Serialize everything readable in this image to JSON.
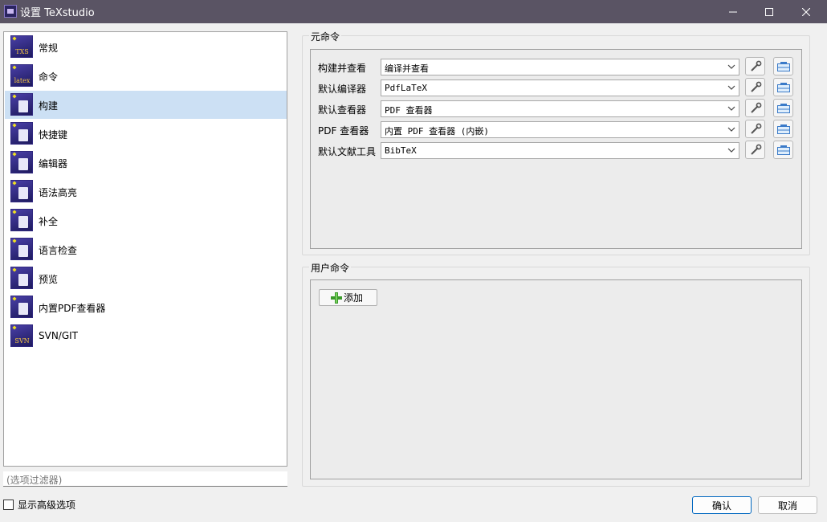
{
  "window": {
    "title": "设置 TeXstudio"
  },
  "sidebar": {
    "items": [
      {
        "label": "常规",
        "icon": "txs-icon",
        "sub": "TXS"
      },
      {
        "label": "命令",
        "icon": "latex-icon",
        "sub": "latex"
      },
      {
        "label": "构建",
        "icon": "build-icon",
        "sub": ""
      },
      {
        "label": "快捷键",
        "icon": "keyboard-icon",
        "sub": ""
      },
      {
        "label": "编辑器",
        "icon": "text-cursor-icon",
        "sub": ""
      },
      {
        "label": "语法高亮",
        "icon": "highlight-icon",
        "sub": ""
      },
      {
        "label": "补全",
        "icon": "completion-icon",
        "sub": ""
      },
      {
        "label": "语言检查",
        "icon": "spellcheck-icon",
        "sub": ""
      },
      {
        "label": "预览",
        "icon": "preview-icon",
        "sub": ""
      },
      {
        "label": "内置PDF查看器",
        "icon": "pdf-viewer-icon",
        "sub": ""
      },
      {
        "label": "SVN/GIT",
        "icon": "svn-icon",
        "sub": "SVN"
      }
    ],
    "selected": "构建",
    "filter_placeholder": "(选项过滤器)"
  },
  "advanced_options": {
    "label": "显示高级选项",
    "checked": false
  },
  "meta_commands": {
    "title": "元命令",
    "rows": [
      {
        "label": "构建并查看",
        "value": "编译并查看"
      },
      {
        "label": "默认编译器",
        "value": "PdfLaTeX"
      },
      {
        "label": "默认查看器",
        "value": "PDF 查看器"
      },
      {
        "label": "PDF 查看器",
        "value": "内置 PDF 查看器 (内嵌)"
      },
      {
        "label": "默认文献工具",
        "value": "BibTeX"
      }
    ]
  },
  "user_commands": {
    "title": "用户命令",
    "add_label": "添加"
  },
  "buttons": {
    "ok": "确认",
    "cancel": "取消"
  },
  "colors": {
    "titlebar": "#5a5464",
    "selected_item": "#cce0f4",
    "ok_border": "#0067c0"
  }
}
